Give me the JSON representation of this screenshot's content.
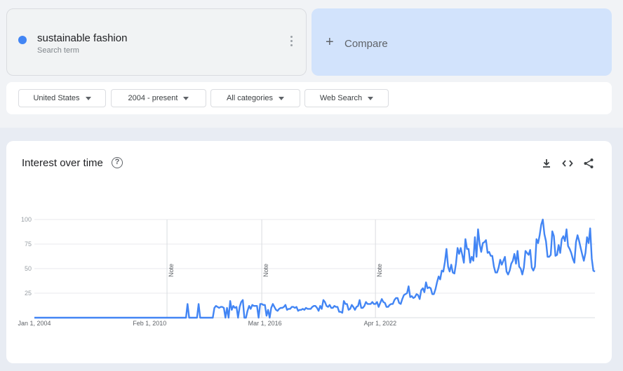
{
  "search_term": {
    "name": "sustainable fashion",
    "subtitle": "Search term",
    "color": "#4285f4"
  },
  "compare": {
    "plus": "+",
    "label": "Compare"
  },
  "filters": [
    {
      "label": "United States"
    },
    {
      "label": "2004 - present"
    },
    {
      "label": "All categories"
    },
    {
      "label": "Web Search"
    }
  ],
  "chart_card": {
    "title": "Interest over time",
    "help_icon": "help-circle-icon",
    "actions": [
      "download-icon",
      "embed-code-icon",
      "share-icon"
    ]
  },
  "chart_data": {
    "type": "line",
    "title": "",
    "xlabel": "",
    "ylabel": "",
    "ylim": [
      0,
      100
    ],
    "yticks": [
      25,
      50,
      75,
      100
    ],
    "x_ticks": [
      "Jan 1, 2004",
      "Feb 1, 2010",
      "Mar 1, 2016",
      "Apr 1, 2022"
    ],
    "notes": [
      {
        "text": "Note",
        "date": "2011-01"
      },
      {
        "text": "Note",
        "date": "2016-01"
      },
      {
        "text": "Note",
        "date": "2022-01"
      }
    ],
    "series": [
      {
        "color": "#4285f4",
        "start": "2004-01",
        "step": "month",
        "values": [
          0,
          0,
          0,
          0,
          0,
          0,
          0,
          0,
          0,
          0,
          0,
          0,
          0,
          0,
          0,
          0,
          0,
          0,
          0,
          0,
          0,
          0,
          0,
          0,
          0,
          0,
          0,
          0,
          0,
          0,
          0,
          0,
          0,
          0,
          0,
          0,
          0,
          0,
          0,
          0,
          0,
          0,
          0,
          0,
          0,
          0,
          0,
          0,
          0,
          0,
          0,
          0,
          0,
          0,
          0,
          0,
          0,
          0,
          0,
          0,
          0,
          0,
          0,
          0,
          0,
          0,
          0,
          0,
          0,
          0,
          0,
          0,
          0,
          0,
          0,
          0,
          0,
          0,
          0,
          0,
          0,
          0,
          0,
          0,
          0,
          0,
          0,
          0,
          0,
          0,
          0,
          0,
          0,
          0,
          0,
          0,
          0,
          14,
          0,
          0,
          0,
          0,
          0,
          0,
          14,
          0,
          0,
          0,
          0,
          0,
          0,
          0,
          0,
          0,
          10,
          12,
          11,
          10,
          11,
          11,
          10,
          0,
          10,
          0,
          17,
          8,
          12,
          10,
          11,
          0,
          11,
          16,
          18,
          0,
          0,
          7,
          12,
          9,
          13,
          12,
          12,
          12,
          0,
          14,
          14,
          13,
          13,
          2,
          8,
          0,
          10,
          14,
          11,
          8,
          7,
          9,
          10,
          10,
          11,
          13,
          8,
          9,
          9,
          11,
          11,
          10,
          11,
          7,
          8,
          8,
          9,
          8,
          10,
          9,
          9,
          9,
          11,
          12,
          12,
          10,
          7,
          12,
          9,
          18,
          16,
          12,
          11,
          13,
          10,
          10,
          12,
          11,
          11,
          6,
          6,
          5,
          17,
          14,
          14,
          8,
          9,
          13,
          11,
          8,
          11,
          12,
          18,
          10,
          10,
          12,
          16,
          14,
          14,
          14,
          16,
          14,
          14,
          16,
          11,
          15,
          19,
          16,
          15,
          11,
          11,
          13,
          14,
          14,
          18,
          20,
          20,
          15,
          14,
          19,
          23,
          24,
          25,
          32,
          21,
          22,
          20,
          21,
          24,
          23,
          19,
          28,
          30,
          26,
          36,
          30,
          31,
          30,
          24,
          24,
          29,
          36,
          42,
          39,
          48,
          47,
          57,
          70,
          52,
          47,
          54,
          46,
          45,
          55,
          71,
          65,
          71,
          64,
          56,
          80,
          70,
          70,
          56,
          62,
          58,
          82,
          62,
          90,
          75,
          67,
          76,
          77,
          79,
          66,
          67,
          63,
          63,
          52,
          46,
          46,
          51,
          59,
          54,
          58,
          62,
          47,
          44,
          48,
          55,
          58,
          65,
          55,
          68,
          52,
          50,
          44,
          51,
          68,
          66,
          64,
          69,
          51,
          48,
          52,
          80,
          76,
          84,
          95,
          100,
          85,
          78,
          62,
          62,
          64,
          88,
          83,
          63,
          64,
          74,
          66,
          80,
          83,
          78,
          90,
          73,
          70,
          66,
          60,
          56,
          77,
          84,
          78,
          71,
          64,
          58,
          66,
          82,
          76,
          91,
          60,
          48,
          47
        ]
      }
    ]
  }
}
